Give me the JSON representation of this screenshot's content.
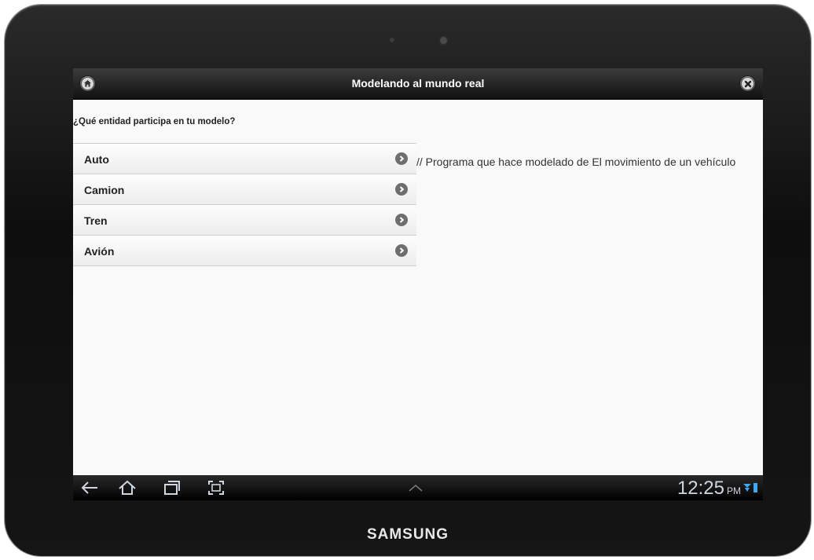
{
  "device": {
    "brand": "SAMSUNG"
  },
  "app": {
    "title": "Modelando al mundo real",
    "home_icon": "home-icon",
    "close_icon": "close-icon"
  },
  "content": {
    "question": "¿Qué entidad participa en tu modelo?",
    "items": [
      {
        "label": "Auto",
        "icon": "chevron-right-icon"
      },
      {
        "label": "Camion",
        "icon": "chevron-right-icon"
      },
      {
        "label": "Tren",
        "icon": "chevron-right-icon"
      },
      {
        "label": "Avión",
        "icon": "chevron-right-icon"
      }
    ],
    "comment": "// Programa que hace modelado de El movimiento de un vehículo"
  },
  "system_bar": {
    "time": "12:25",
    "ampm": "PM",
    "nav_icons": [
      "back-icon",
      "home-outline-icon",
      "recent-apps-icon",
      "screenshot-icon",
      "up-caret-icon"
    ],
    "status_icons": [
      "wifi-icon",
      "battery-icon"
    ]
  },
  "colors": {
    "header_bg": "#111111",
    "header_text": "#ffffff",
    "list_bg": "#f0f0f0",
    "clock": "#cfd6dd",
    "status_blue": "#3fa9f5"
  }
}
